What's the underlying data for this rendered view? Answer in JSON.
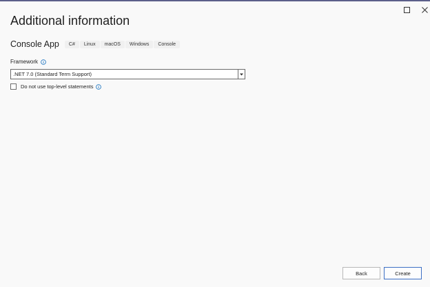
{
  "window": {
    "maximize_icon": "maximize-icon",
    "close_icon": "close-icon"
  },
  "heading": "Additional information",
  "project": {
    "name": "Console App",
    "tags": [
      "C#",
      "Linux",
      "macOS",
      "Windows",
      "Console"
    ]
  },
  "framework": {
    "label": "Framework",
    "selected": ".NET 7.0 (Standard Term Support)"
  },
  "top_level_statements": {
    "label": "Do not use top-level statements",
    "checked": false
  },
  "buttons": {
    "back": "Back",
    "create": "Create"
  },
  "colors": {
    "accent": "#3c6fc4",
    "info_icon": "#0f6cbd",
    "title_bar": "#5b5f8a"
  }
}
